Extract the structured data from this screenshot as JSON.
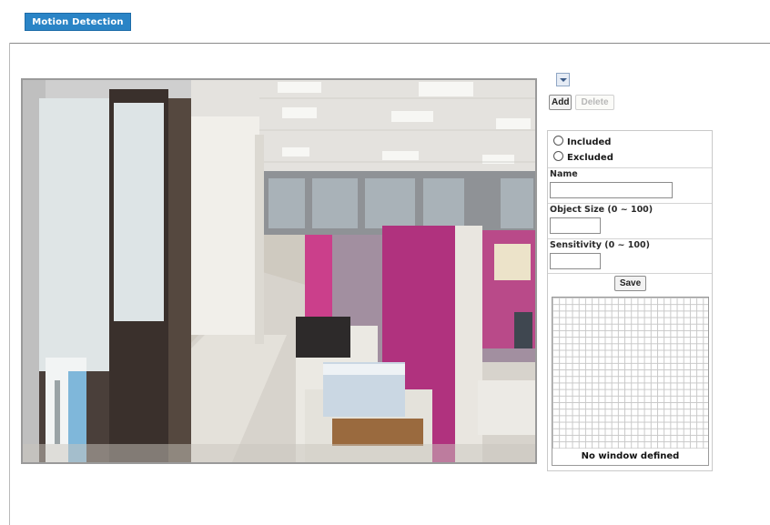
{
  "header": {
    "title": "Motion Detection"
  },
  "window_controls": {
    "add_label": "Add",
    "delete_label": "Delete"
  },
  "window_type": {
    "included_label": "Included",
    "excluded_label": "Excluded"
  },
  "form": {
    "name_label": "Name",
    "name_value": "",
    "object_size_label": "Object Size   (0 ~ 100)",
    "object_size_value": "",
    "sensitivity_label": "Sensitivity   (0 ~ 100)",
    "sensitivity_value": "",
    "save_label": "Save"
  },
  "grid": {
    "message": "No window defined"
  },
  "colors": {
    "accent": "#2a84c6"
  }
}
